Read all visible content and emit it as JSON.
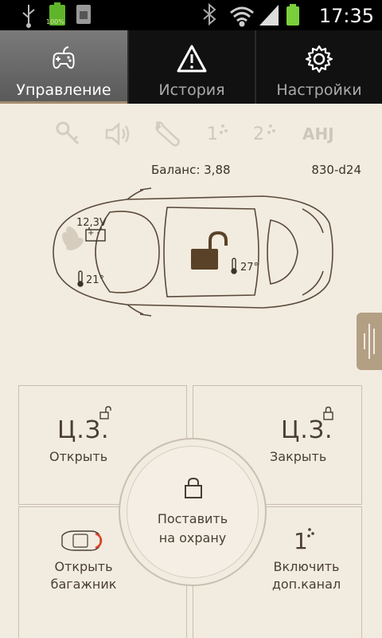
{
  "status_bar": {
    "battery_pct": "100%",
    "time": "17:35"
  },
  "tabs": [
    {
      "label": "Управление",
      "icon": "gamepad-icon",
      "active": true
    },
    {
      "label": "История",
      "icon": "warning-icon",
      "active": false
    },
    {
      "label": "Настройки",
      "icon": "gear-icon",
      "active": false
    }
  ],
  "indicators": {
    "channel1_num": "1",
    "channel2_num": "2",
    "ahj": "AHJ"
  },
  "info": {
    "balance": "Баланс: 3,88",
    "device_id": "830-d24"
  },
  "car": {
    "voltage": "12,3V",
    "battery_symbols": "+ -",
    "outside_temp": "21°",
    "inside_temp": "27°"
  },
  "controls": {
    "unlock_code": "Ц.З.",
    "unlock_label": "Открыть",
    "lock_code": "Ц.З.",
    "lock_label": "Закрыть",
    "arm_line1": "Поставить",
    "arm_line2": "на охрану",
    "trunk_line1": "Открыть",
    "trunk_line2": "багажник",
    "aux_num": "1",
    "aux_line1": "Включить",
    "aux_line2": "доп.канал"
  },
  "colors": {
    "background": "#f2ebe0",
    "accent_brown": "#4a3e32",
    "lock_brown": "#5a4228",
    "tab_active": "#6b6b6b"
  }
}
